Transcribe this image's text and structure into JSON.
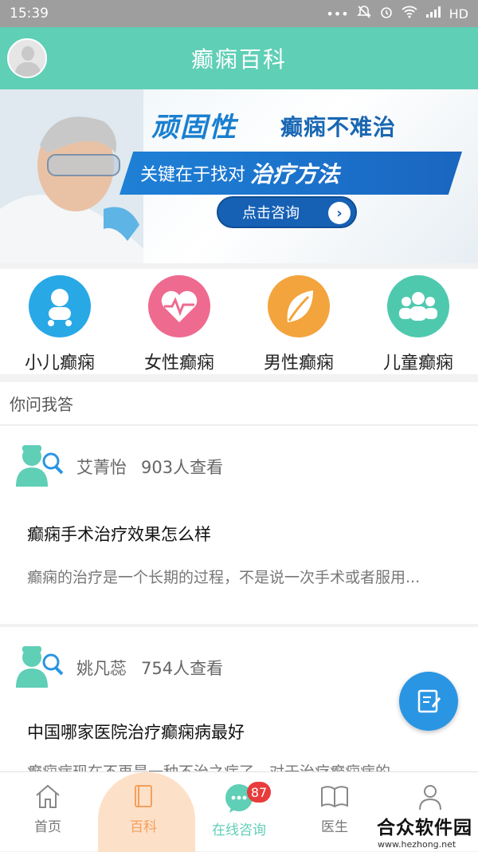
{
  "status_bar": {
    "time": "15:39",
    "dots": "•••",
    "network": "HD"
  },
  "header": {
    "title": "癫痫百科"
  },
  "banner": {
    "headline_1": "顽固性",
    "headline_2": "癫痫不难治",
    "subline": "关键在于找对",
    "subline_highlight": "治疗方法",
    "button_label": "点击咨询"
  },
  "categories": [
    {
      "label": "小儿癫痫",
      "color": "#29a8e6",
      "icon": "baby-icon"
    },
    {
      "label": "女性癫痫",
      "color": "#ee6a8f",
      "icon": "heartbeat-icon"
    },
    {
      "label": "男性癫痫",
      "color": "#f3a43c",
      "icon": "leaf-icon"
    },
    {
      "label": "儿童癫痫",
      "color": "#4fc9ae",
      "icon": "group-icon"
    }
  ],
  "section": {
    "title": "你问我答"
  },
  "questions": [
    {
      "author": "艾菁怡",
      "views": "903人查看",
      "title": "癫痫手术治疗效果怎么样",
      "summary": "癫痫的治疗是一个长期的过程，不是说一次手术或者服用..."
    },
    {
      "author": "姚凡蕊",
      "views": "754人查看",
      "title": "中国哪家医院治疗癫痫病最好",
      "summary": "癫痫病现在不再是一种不治之症了，对于治疗癫痫病的"
    }
  ],
  "tabbar": {
    "tabs": [
      {
        "label": "首页",
        "icon": "home-icon"
      },
      {
        "label": "百科",
        "icon": "book-icon"
      },
      {
        "label": "在线咨询",
        "icon": "chat-icon"
      },
      {
        "label": "医生",
        "icon": "open-book-icon"
      },
      {
        "label": "我的",
        "icon": "person-icon"
      }
    ],
    "active_index": 1,
    "badge_count": "87"
  },
  "watermark": {
    "title": "合众软件园",
    "url": "www.hezhong.net"
  },
  "colors": {
    "primary": "#5fcfb6",
    "accent": "#f3a05c",
    "fab": "#2a95e3"
  }
}
